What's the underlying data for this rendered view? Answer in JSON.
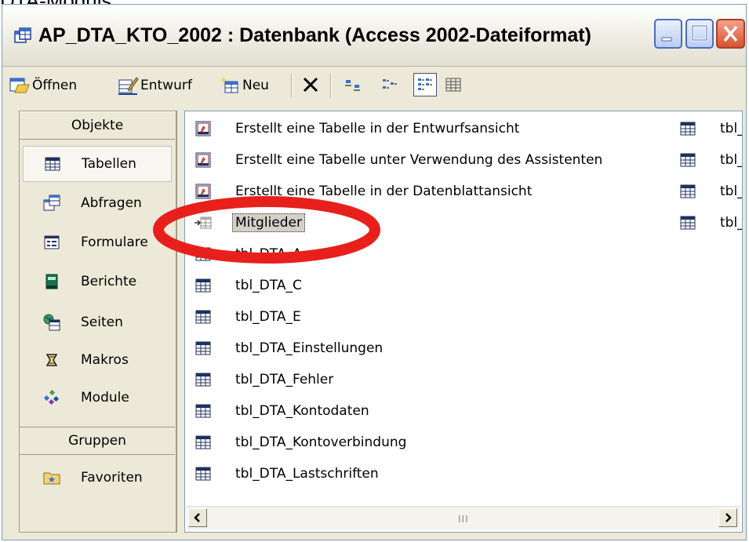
{
  "caption": "DTA-Moduls:",
  "window": {
    "title": "AP_DTA_KTO_2002 : Datenbank (Access 2002-Dateiformat)"
  },
  "toolbar": {
    "open_label": "Öffnen",
    "design_label": "Entwurf",
    "new_label": "Neu"
  },
  "sidebar": {
    "objects_header": "Objekte",
    "groups_header": "Gruppen",
    "items": [
      {
        "label": "Tabellen",
        "icon": "table-icon"
      },
      {
        "label": "Abfragen",
        "icon": "query-icon"
      },
      {
        "label": "Formulare",
        "icon": "form-icon"
      },
      {
        "label": "Berichte",
        "icon": "report-icon"
      },
      {
        "label": "Seiten",
        "icon": "page-icon"
      },
      {
        "label": "Makros",
        "icon": "macro-icon"
      },
      {
        "label": "Module",
        "icon": "module-icon"
      }
    ],
    "groups": [
      {
        "label": "Favoriten",
        "icon": "favorites-icon"
      }
    ]
  },
  "list": {
    "items": [
      {
        "label": "Erstellt eine Tabelle in der Entwurfsansicht",
        "icon": "shortcut-icon"
      },
      {
        "label": "Erstellt eine Tabelle unter Verwendung des Assistenten",
        "icon": "shortcut-icon"
      },
      {
        "label": "Erstellt eine Tabelle in der Datenblattansicht",
        "icon": "shortcut-icon"
      },
      {
        "label": "Mitglieder",
        "icon": "linked-table-icon",
        "selected": true
      },
      {
        "label": "tbl_DTA_A",
        "icon": "table-icon"
      },
      {
        "label": "tbl_DTA_C",
        "icon": "table-icon"
      },
      {
        "label": "tbl_DTA_E",
        "icon": "table-icon"
      },
      {
        "label": "tbl_DTA_Einstellungen",
        "icon": "table-icon"
      },
      {
        "label": "tbl_DTA_Fehler",
        "icon": "table-icon"
      },
      {
        "label": "tbl_DTA_Kontodaten",
        "icon": "table-icon"
      },
      {
        "label": "tbl_DTA_Kontoverbindung",
        "icon": "table-icon"
      },
      {
        "label": "tbl_DTA_Lastschriften",
        "icon": "table-icon"
      }
    ],
    "second_column": [
      "tbl_",
      "tbl_",
      "tbl_",
      "tbl_"
    ]
  },
  "scrollbar": {
    "grip": "III"
  },
  "colors": {
    "annotation": "#e8201c",
    "window_border": "#7f9db9",
    "face": "#ece9d8"
  }
}
